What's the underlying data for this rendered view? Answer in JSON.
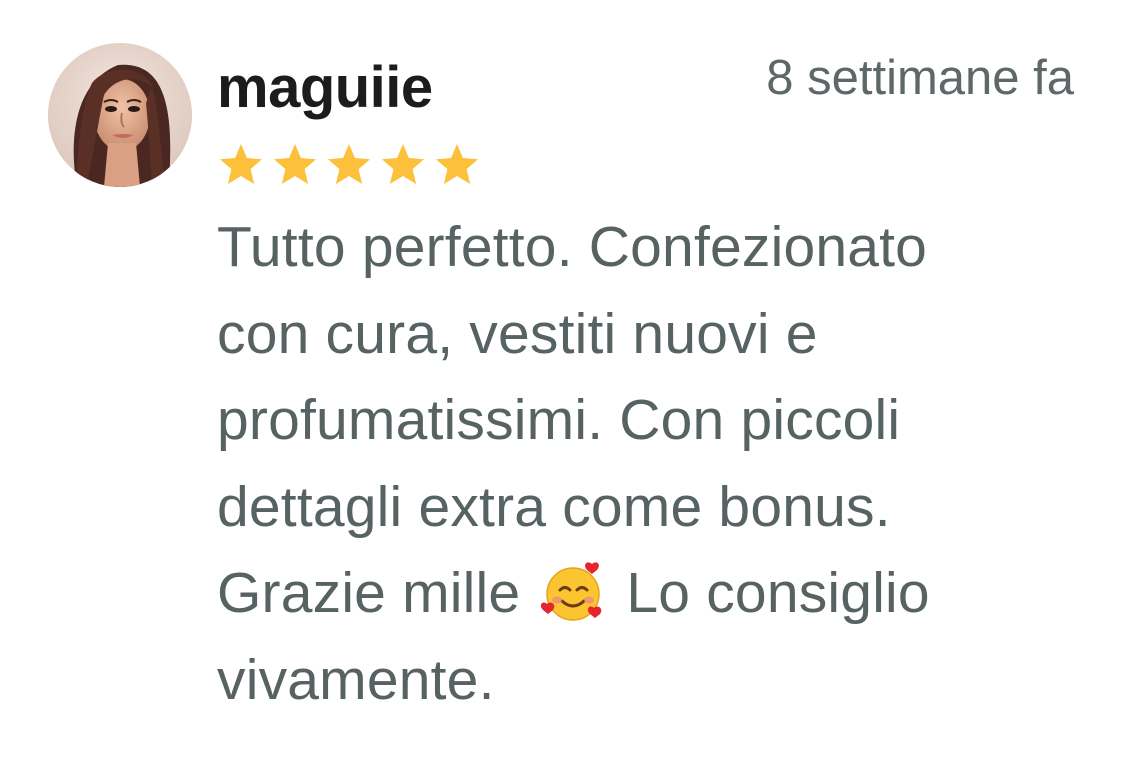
{
  "review": {
    "username": "maguiie",
    "timestamp": "8 settimane fa",
    "rating": 5,
    "rating_max": 5,
    "star_color": "#fcc03a",
    "avatar_icon": "user-avatar-photo",
    "text_lines": [
      "Tutto perfetto. Confezionato",
      "con cura, vestiti nuovi e",
      "profumatissimi. Con piccoli",
      "dettagli extra come bonus.",
      "Grazie mille",
      "Lo consiglio",
      "vivamente."
    ],
    "emoji": "smiling-face-with-hearts"
  }
}
